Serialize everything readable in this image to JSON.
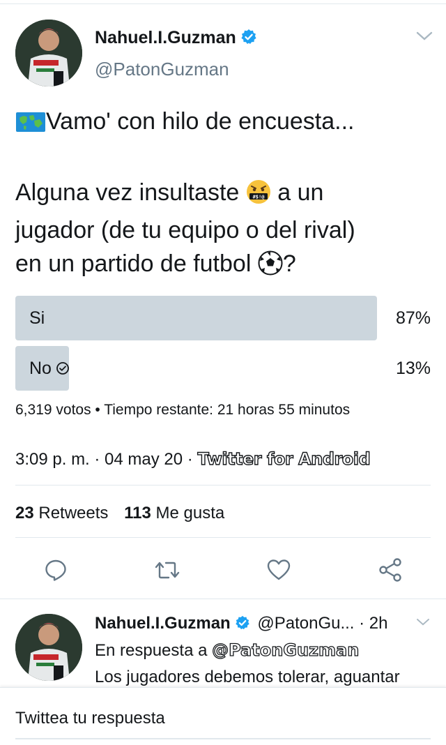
{
  "tweet": {
    "author_name": "Nahuel.I.Guzman",
    "handle": "@PatonGuzman",
    "text_line1": "Vamo' con hilo de encuesta...",
    "question_part1": "Alguna vez insultaste",
    "question_part2": " a un",
    "question_line2": "jugador (de tu equipo o del rival)",
    "question_line3": "en un partido de futbol",
    "question_end": "?",
    "icons": [
      "map-emoji",
      "cursing-face-emoji",
      "soccer-ball-emoji",
      "verified-badge-icon",
      "chevron-down-icon"
    ]
  },
  "poll": {
    "options": [
      {
        "label": "Si",
        "percent_text": "87%",
        "percent": 87
      },
      {
        "label": "No",
        "percent_text": "13%",
        "percent": 13
      }
    ],
    "meta": "6,319 votos • Tiempo restante: 21 horas 55 minutos",
    "bar_color": "#ccd6dd"
  },
  "meta": {
    "timestamp": "3:09 p. m. · 04 may 20 · ",
    "source": "Twitter for Android"
  },
  "stats": {
    "retweets_count": "23",
    "retweets_label": "Retweets",
    "likes_count": "113",
    "likes_label": "Me gusta"
  },
  "actions": [
    "reply-icon",
    "retweet-icon",
    "like-icon",
    "share-icon"
  ],
  "reply": {
    "author_name": "Nahuel.I.Guzman",
    "handle_time": "@PatonGu... · 2h",
    "in_reply_prefix": "En respuesta a ",
    "in_reply_mention": "@PatonGuzman",
    "text": "Los jugadores debemos tolerar, aguantar"
  },
  "compose": {
    "placeholder": "Twittea tu respuesta"
  },
  "colors": {
    "accent": "#1da1f2",
    "secondary_text": "#657786",
    "icon_gray": "#657786"
  }
}
